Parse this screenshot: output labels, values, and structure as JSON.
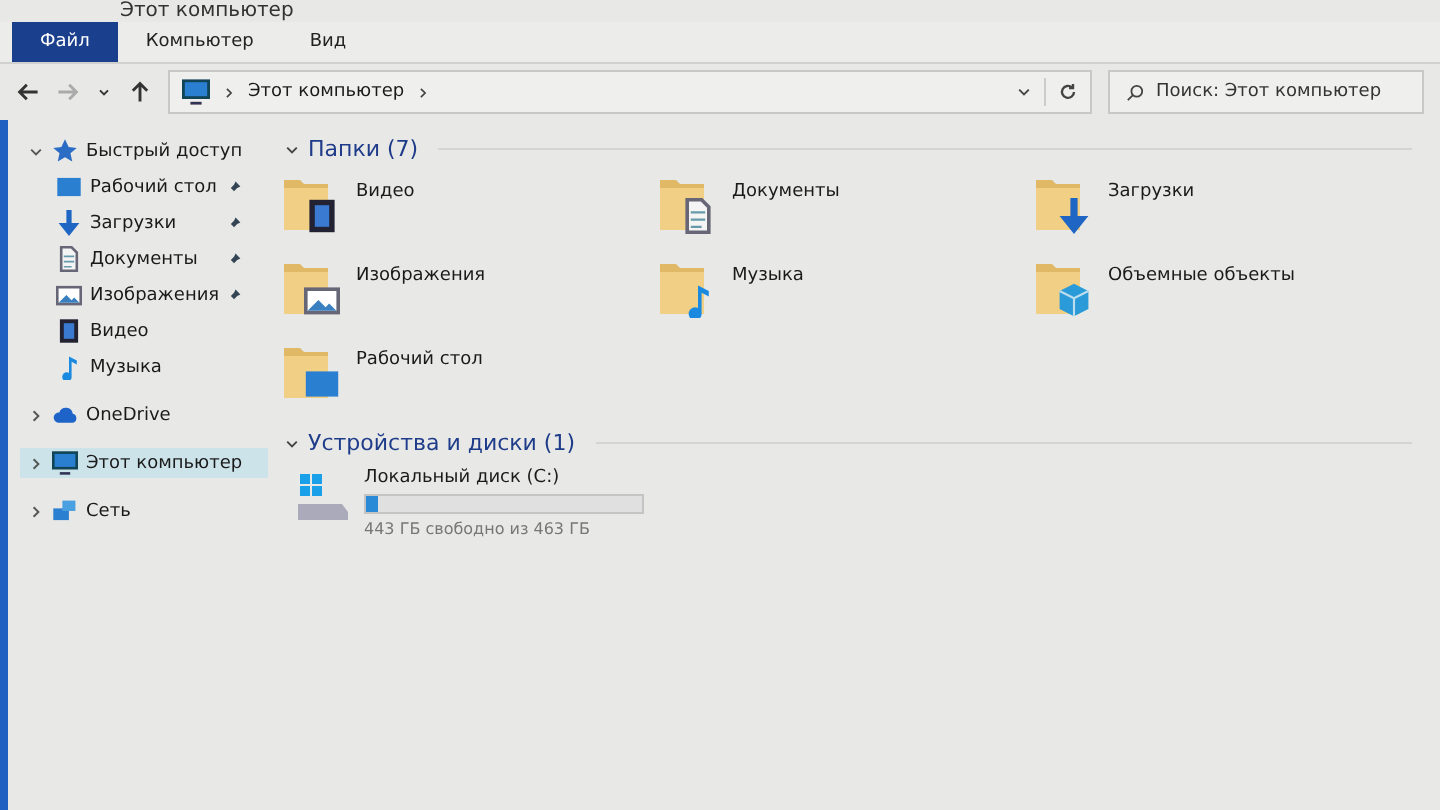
{
  "window": {
    "title": "Этот компьютер"
  },
  "ribbon_tabs": [
    {
      "label": "Файл",
      "selected": true
    },
    {
      "label": "Компьютер",
      "selected": false
    },
    {
      "label": "Вид",
      "selected": false
    }
  ],
  "address": {
    "path": "Этот компьютер"
  },
  "search": {
    "placeholder": "Поиск: Этот компьютер"
  },
  "sidebar": {
    "items": [
      {
        "label": "Быстрый доступ",
        "kind": "star",
        "expanded": true,
        "selected": false,
        "children": [
          {
            "label": "Рабочий стол",
            "kind": "desktop",
            "pinned": true
          },
          {
            "label": "Загрузки",
            "kind": "downloads",
            "pinned": true
          },
          {
            "label": "Документы",
            "kind": "docs",
            "pinned": true
          },
          {
            "label": "Изображения",
            "kind": "pictures",
            "pinned": true
          },
          {
            "label": "Видео",
            "kind": "video",
            "pinned": false
          },
          {
            "label": "Музыка",
            "kind": "music",
            "pinned": false
          }
        ]
      },
      {
        "label": "OneDrive",
        "kind": "cloud",
        "expanded": false,
        "selected": false
      },
      {
        "label": "Этот компьютер",
        "kind": "pc",
        "expanded": false,
        "selected": true
      },
      {
        "label": "Сеть",
        "kind": "network",
        "expanded": false,
        "selected": false
      }
    ]
  },
  "folders": {
    "title": "Папки (7)",
    "items": [
      {
        "label": "Видео",
        "kind": "video"
      },
      {
        "label": "Документы",
        "kind": "docs"
      },
      {
        "label": "Загрузки",
        "kind": "downloads"
      },
      {
        "label": "Изображения",
        "kind": "pictures"
      },
      {
        "label": "Музыка",
        "kind": "music"
      },
      {
        "label": "Объемные объекты",
        "kind": "cube"
      },
      {
        "label": "Рабочий стол",
        "kind": "desktop"
      }
    ]
  },
  "devices": {
    "title": "Устройства и диски (1)",
    "items": [
      {
        "label": "Локальный диск (C:)",
        "level": 0.04,
        "free": "443 ГБ свободно из 463 ГБ"
      }
    ]
  }
}
